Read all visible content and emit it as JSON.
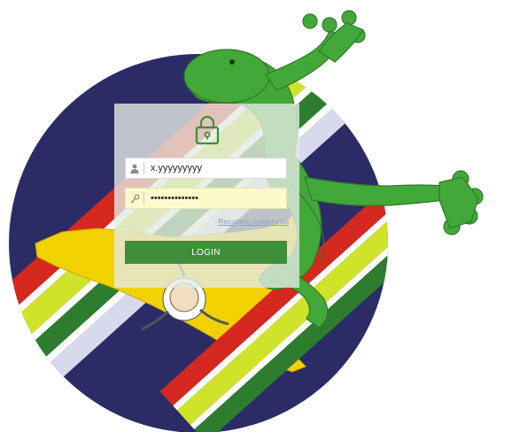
{
  "login": {
    "username_value": "x.yyyyyyyyy",
    "password_value": "••••••••••••••",
    "recover_label": "Recupero credenziali",
    "login_label": "LOGIN"
  },
  "icons": {
    "lock": "lock-icon",
    "user": "user-icon",
    "key": "key-icon"
  },
  "colors": {
    "panel_bg": "#e4eae2",
    "login_button": "#3e8e3a",
    "password_field_bg": "#fafacb",
    "link": "#8fa0b4",
    "gecko_green": "#43a83a",
    "circle_navy": "#2b2c66",
    "stripe_red": "#d5281f",
    "stripe_yellow_green": "#cfe32a",
    "stripe_dark_green": "#2e7d2e",
    "sicily_yellow": "#f2d100"
  }
}
